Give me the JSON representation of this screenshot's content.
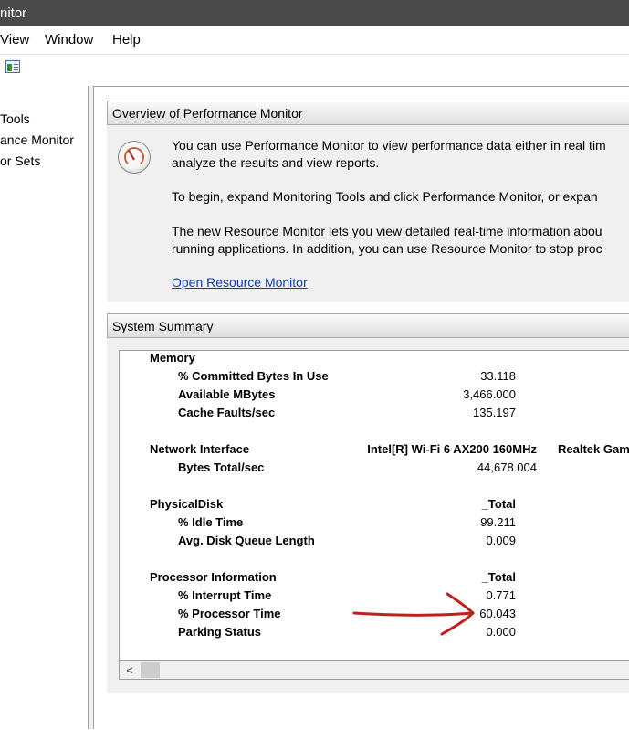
{
  "window": {
    "title": "nitor"
  },
  "menu": [
    "View",
    "Window",
    "Help"
  ],
  "tree": [
    "Tools",
    "ance Monitor",
    "or Sets"
  ],
  "overview": {
    "header": "Overview of Performance Monitor",
    "para1_line1": "You can use Performance Monitor to view performance data either in real tim",
    "para1_line2": "analyze the results and view reports.",
    "para2": "To begin, expand Monitoring Tools and click Performance Monitor, or expan",
    "para3_line1": "The new Resource Monitor lets you view detailed real-time information abou",
    "para3_line2": "running applications. In addition, you can use Resource Monitor to stop proc",
    "link": "Open Resource Monitor",
    "icon": "performance-gauge-icon"
  },
  "summary": {
    "header": "System Summary",
    "groups": [
      {
        "name": "Memory",
        "instance": "",
        "instance2": "",
        "counters": [
          {
            "label": "% Committed Bytes In Use",
            "value": "33.118"
          },
          {
            "label": "Available MBytes",
            "value": "3,466.000"
          },
          {
            "label": "Cache Faults/sec",
            "value": "135.197"
          }
        ]
      },
      {
        "name": "Network Interface",
        "instance": "Intel[R] Wi-Fi 6 AX200 160MHz",
        "instance2": "Realtek Gam",
        "counters": [
          {
            "label": "Bytes Total/sec",
            "value": "44,678.004"
          }
        ]
      },
      {
        "name": "PhysicalDisk",
        "instance": "_Total",
        "instance2": "",
        "counters": [
          {
            "label": "% Idle Time",
            "value": "99.211"
          },
          {
            "label": "Avg. Disk Queue Length",
            "value": "0.009"
          }
        ]
      },
      {
        "name": "Processor Information",
        "instance": "_Total",
        "instance2": "",
        "counters": [
          {
            "label": "% Interrupt Time",
            "value": "0.771"
          },
          {
            "label": "% Processor Time",
            "value": "60.043"
          },
          {
            "label": "Parking Status",
            "value": "0.000"
          }
        ]
      }
    ],
    "scroll_left_glyph": "<"
  },
  "annotation": {
    "color": "#c0201c"
  }
}
